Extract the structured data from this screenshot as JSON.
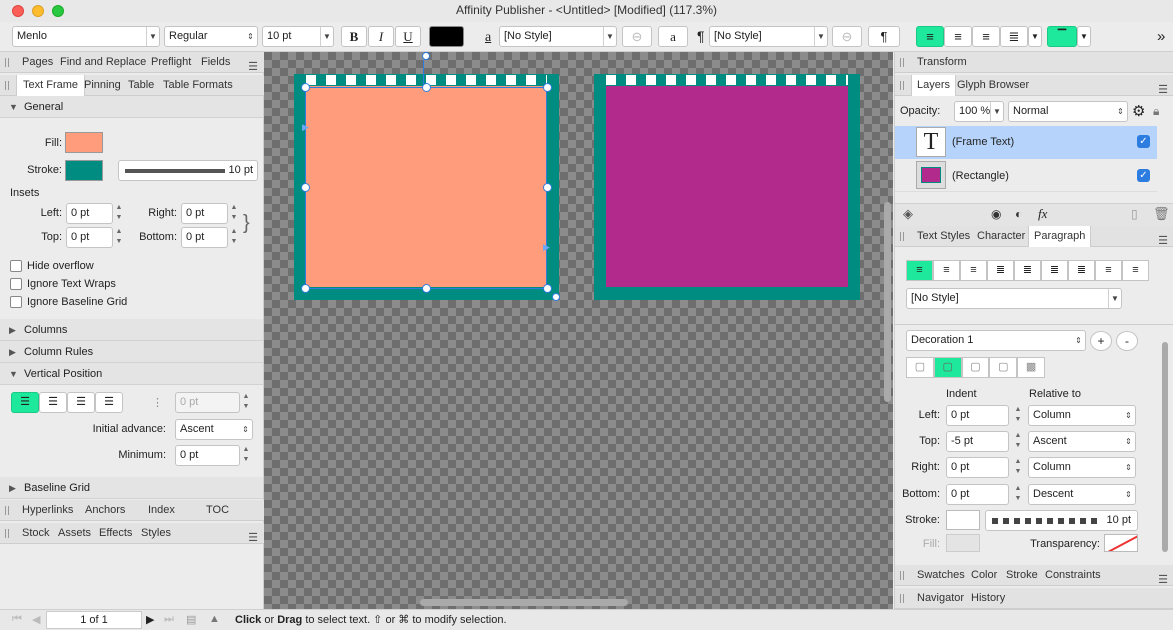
{
  "window": {
    "title": "Affinity Publisher - <Untitled> [Modified] (117.3%)"
  },
  "toolbar": {
    "font": "Menlo",
    "style": "Regular",
    "size": "10 pt",
    "bold": "B",
    "italic": "I",
    "underline": "U",
    "char_style_glyph": "a",
    "char_style": "[No Style]",
    "para_glyph": "¶",
    "para_style": "[No Style]",
    "overflow": "»"
  },
  "left": {
    "studio_tabs": [
      "Pages",
      "Find and Replace",
      "Preflight",
      "Fields"
    ],
    "tabs": [
      "Text Frame",
      "Pinning",
      "Table",
      "Table Formats"
    ],
    "general": "General",
    "fill_label": "Fill:",
    "stroke_label": "Stroke:",
    "stroke_width": "10 pt",
    "insets": "Insets",
    "left_label": "Left:",
    "left_val": "0 pt",
    "right_label": "Right:",
    "right_val": "0 pt",
    "top_label": "Top:",
    "top_val": "0 pt",
    "bottom_label": "Bottom:",
    "bottom_val": "0 pt",
    "hide_overflow": "Hide overflow",
    "ignore_wraps": "Ignore Text Wraps",
    "ignore_baseline": "Ignore Baseline Grid",
    "columns": "Columns",
    "column_rules": "Column Rules",
    "vertical_position": "Vertical Position",
    "vp_value": "0 pt",
    "initial_advance_label": "Initial advance:",
    "initial_advance": "Ascent",
    "minimum_label": "Minimum:",
    "minimum": "0 pt",
    "baseline_grid": "Baseline Grid",
    "tabs2": [
      "Hyperlinks",
      "Anchors",
      "Index",
      "TOC"
    ],
    "tabs3": [
      "Stock",
      "Assets",
      "Effects",
      "Styles"
    ]
  },
  "right": {
    "transform": "Transform",
    "layer_tabs": [
      "Layers",
      "Glyph Browser"
    ],
    "opacity_label": "Opacity:",
    "opacity": "100 %",
    "blend": "Normal",
    "layers": [
      {
        "name": "(Frame Text)"
      },
      {
        "name": "(Rectangle)"
      }
    ],
    "text_tabs": [
      "Text Styles",
      "Character",
      "Paragraph"
    ],
    "para_style": "[No Style]",
    "decoration": "Decoration 1",
    "plus": "+",
    "minus": "-",
    "indent_label": "Indent",
    "relative_label": "Relative to",
    "rows": [
      {
        "label": "Left:",
        "value": "0 pt",
        "rel": "Column"
      },
      {
        "label": "Top:",
        "value": "-5 pt",
        "rel": "Ascent"
      },
      {
        "label": "Right:",
        "value": "0 pt",
        "rel": "Column"
      },
      {
        "label": "Bottom:",
        "value": "0 pt",
        "rel": "Descent"
      }
    ],
    "stroke_label": "Stroke:",
    "stroke_width": "10 pt",
    "fill_label": "Fill:",
    "transparency_label": "Transparency:",
    "bottom_tabs": [
      "Swatches",
      "Color",
      "Stroke",
      "Constraints"
    ],
    "nav_tabs": [
      "Navigator",
      "History"
    ]
  },
  "status": {
    "page": "1 of 1",
    "click": "Click",
    "or1": " or ",
    "drag": "Drag",
    "rest": " to select text. ⇧ or ⌘ to modify selection."
  },
  "colors": {
    "accent": "#1ee89c",
    "frame_fill": "#ff9c7b",
    "teal": "#008c80",
    "magenta": "#b22b8c",
    "selection": "#b6d4fb"
  }
}
